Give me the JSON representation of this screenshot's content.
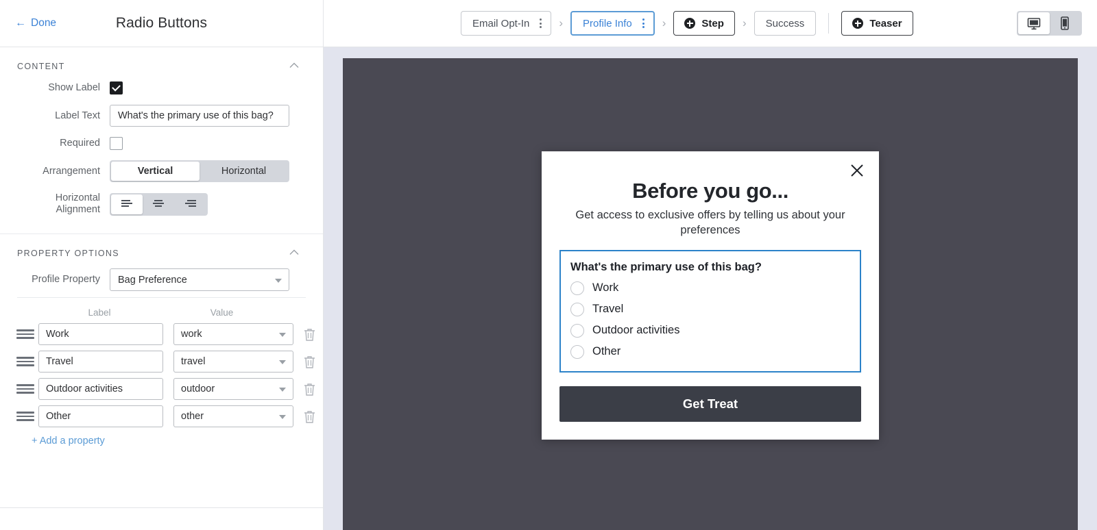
{
  "panel": {
    "done_label": "Done",
    "back_icon": "←",
    "title": "Radio Buttons",
    "content_section": {
      "title": "CONTENT",
      "collapse_icon": "⌃",
      "show_label": {
        "label": "Show Label",
        "checked": true
      },
      "label_text": {
        "label": "Label Text",
        "value": "What's the primary use of this bag?"
      },
      "required": {
        "label": "Required",
        "checked": false
      },
      "arrangement": {
        "label": "Arrangement",
        "options": [
          "Vertical",
          "Horizontal"
        ],
        "selected": "Vertical"
      },
      "horizontal_alignment": {
        "label": "Horizontal Alignment",
        "options": [
          "align-left",
          "align-center",
          "align-right"
        ],
        "selected": "align-left"
      }
    },
    "property_options_section": {
      "title": "PROPERTY OPTIONS",
      "collapse_icon": "⌃",
      "profile_property": {
        "label": "Profile Property",
        "value": "Bag Preference"
      },
      "columns": {
        "label": "Label",
        "value": "Value"
      },
      "rows": [
        {
          "label": "Work",
          "value": "work"
        },
        {
          "label": "Travel",
          "value": "travel"
        },
        {
          "label": "Outdoor activities",
          "value": "outdoor"
        },
        {
          "label": "Other",
          "value": "other"
        }
      ],
      "add_property": "+ Add a property"
    }
  },
  "topbar": {
    "steps": [
      {
        "label": "Email Opt-In",
        "active": false,
        "has_menu": true
      },
      {
        "label": "Profile Info",
        "active": true,
        "has_menu": true
      },
      {
        "label": "Success",
        "active": false,
        "has_menu": false
      }
    ],
    "separator": "›",
    "add_step_label": "Step",
    "add_teaser_label": "Teaser",
    "devices": [
      {
        "name": "desktop",
        "active": true
      },
      {
        "name": "mobile",
        "active": false
      }
    ]
  },
  "preview": {
    "close_icon": "✕",
    "title": "Before you go...",
    "subtitle": "Get access to exclusive offers by telling us about your preferences",
    "question": "What's the primary use of this bag?",
    "choices": [
      "Work",
      "Travel",
      "Outdoor activities",
      "Other"
    ],
    "cta_label": "Get Treat"
  },
  "colors": {
    "accent_blue": "#3b82d6",
    "active_border": "#5b9bd5",
    "canvas_bg": "#4a4953",
    "canvas_frame": "#e2e4ee",
    "cta_bg": "#3b3e47",
    "radio_block_border": "#2b82c9"
  }
}
